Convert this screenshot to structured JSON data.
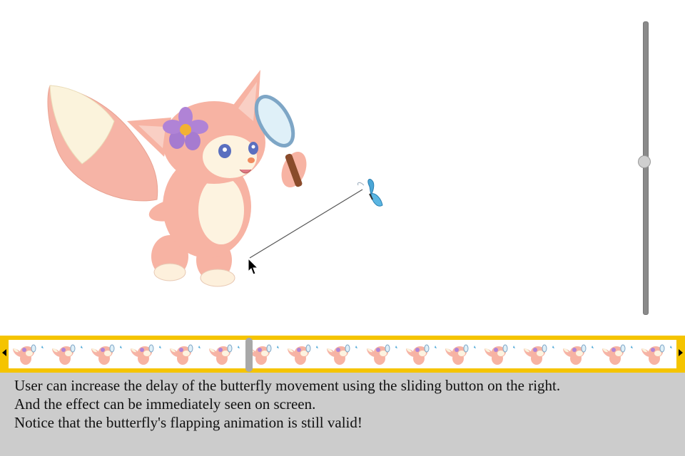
{
  "stage": {
    "character_icon": "fox-with-magnifier-illustration",
    "butterfly_icon": "blue-butterfly-icon",
    "cursor_icon": "mouse-pointer-icon",
    "trail_color": "#555555"
  },
  "delay_slider": {
    "orientation": "vertical",
    "value_fraction": 0.48
  },
  "filmstrip": {
    "frame_count": 17,
    "frame_icon": "fox-thumbnail-icon",
    "playhead_fraction": 0.36,
    "left_arrow_icon": "triangle-left-icon",
    "right_arrow_icon": "triangle-right-icon",
    "border_color": "#f5c400"
  },
  "caption": {
    "line1": "User can increase the delay of the butterfly movement using the sliding button on the right.",
    "line2": "And the effect can be immediately seen on screen.",
    "line3": "Notice that the butterfly's flapping animation is still valid!"
  }
}
